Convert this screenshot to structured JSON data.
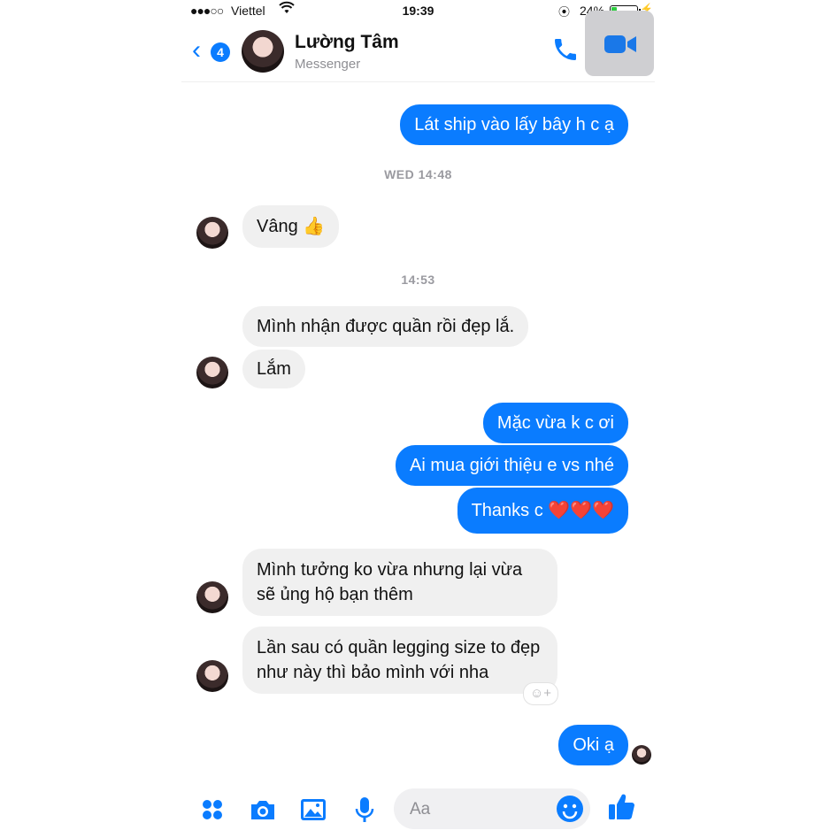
{
  "status_bar": {
    "signal": "●●●○○",
    "carrier": "Viettel",
    "time": "19:39",
    "battery_percent": "24%",
    "battery_level": 0.24
  },
  "header": {
    "unread_count": "4",
    "contact_name": "Lường Tâm",
    "subtitle": "Messenger",
    "accent_color": "#0a7cff"
  },
  "messages": [
    {
      "side": "out",
      "text": "Lát ship vào lấy bây h c ạ"
    },
    {
      "side": "in",
      "text": "Vâng 👍"
    },
    {
      "side": "in",
      "text": "Mình nhận được quần rồi đẹp lắ."
    },
    {
      "side": "in",
      "text": "Lắm"
    },
    {
      "side": "out",
      "text": "Mặc vừa k c ơi"
    },
    {
      "side": "out",
      "text": "Ai mua giới thiệu e vs nhé"
    },
    {
      "side": "out",
      "text": "Thanks c",
      "emoji": "❤️❤️❤️"
    },
    {
      "side": "in",
      "text": "Mình tưởng ko vừa nhưng lại vừa sẽ ủng hộ bạn thêm"
    },
    {
      "side": "in",
      "text": "Lần sau có quần legging size to đẹp như này thì bảo mình với nha"
    },
    {
      "side": "out",
      "text": "Oki ạ"
    }
  ],
  "timestamps": [
    "WED 14:48",
    "14:53"
  ],
  "composer": {
    "placeholder": "Aa",
    "icons": [
      "apps-icon",
      "camera-icon",
      "image-icon",
      "microphone-icon",
      "smile-icon",
      "thumbs-up-icon"
    ]
  }
}
